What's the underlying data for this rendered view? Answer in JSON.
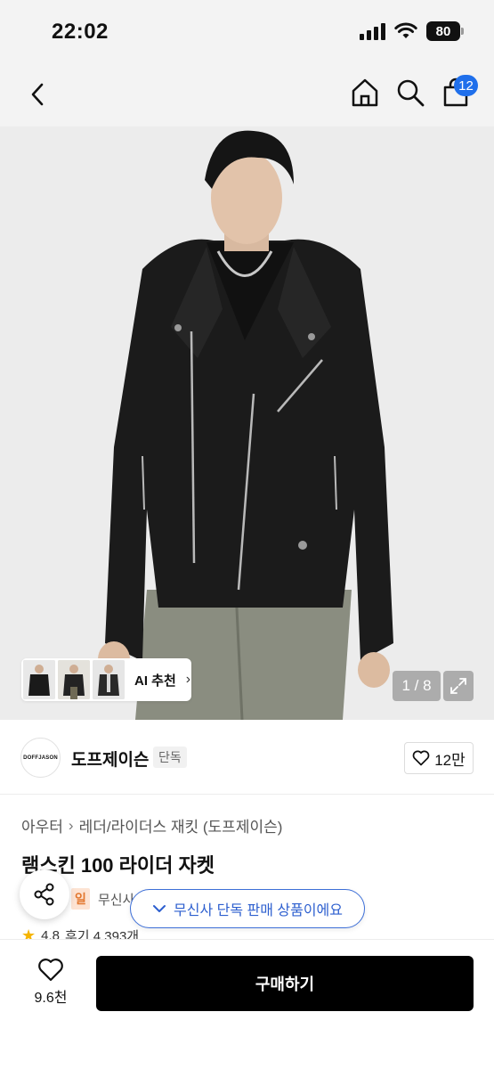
{
  "status_bar": {
    "time": "22:02",
    "battery": "80"
  },
  "nav": {
    "cart_badge": "12",
    "icons": [
      "chevron-left-icon",
      "home-icon",
      "search-icon",
      "shopping-bag-icon"
    ]
  },
  "gallery": {
    "counter": "1 / 8",
    "ai_recommend_label": "AI 추천"
  },
  "brand": {
    "logo_text": "DOFFJASON",
    "name": "도프제이슨",
    "tag": "단독",
    "like_count": "12만"
  },
  "breadcrumb": {
    "category": "아우터",
    "subcategory": "레더/라이더스 재킷 (도프제이슨)"
  },
  "product": {
    "title": "램스킨 100 라이더 자켓",
    "sale_badge": "일",
    "store_label": "무신사",
    "rating": "4.8",
    "review_label": "후기 4,393개"
  },
  "exclusive_pill": {
    "label": "무신사 단독 판매 상품이에요"
  },
  "bottom_bar": {
    "wish_count": "9.6천",
    "buy_label": "구매하기"
  },
  "colors": {
    "accent_blue": "#1f6feb",
    "buy_button": "#000000",
    "sale_orange": "#e2772f"
  }
}
